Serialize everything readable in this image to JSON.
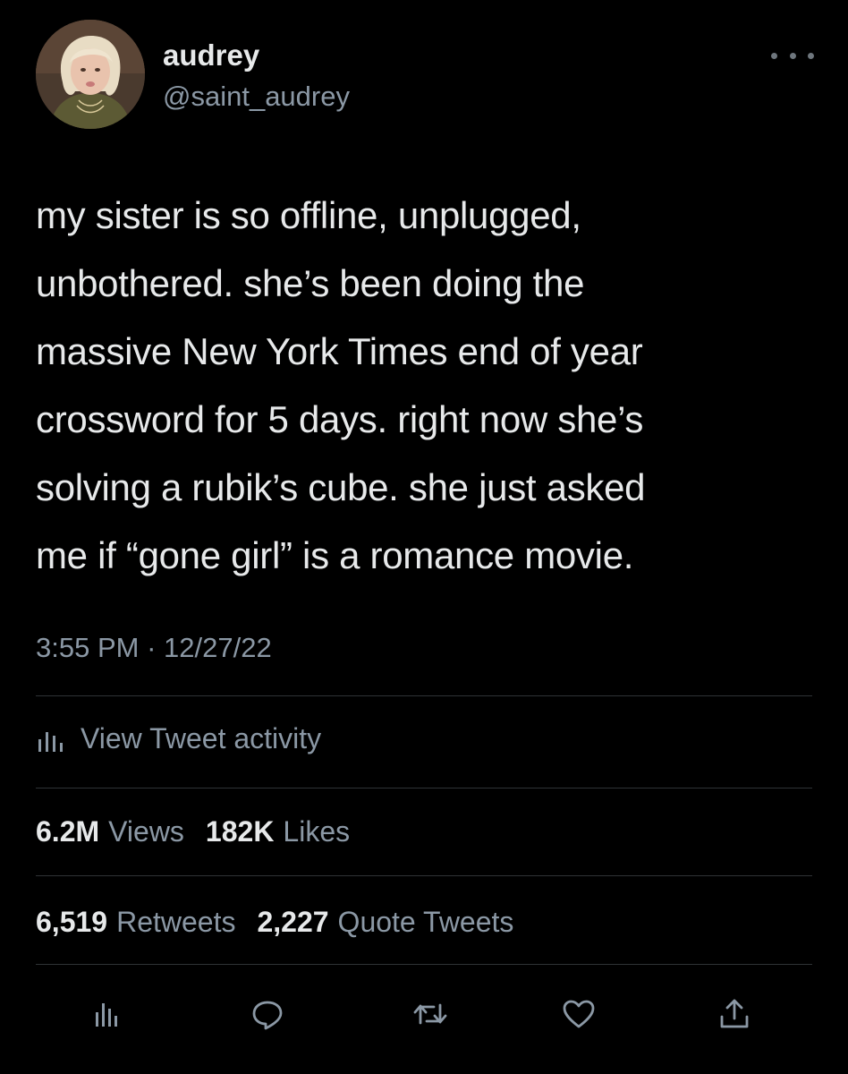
{
  "author": {
    "display_name": "audrey",
    "handle": "@saint_audrey",
    "avatar_icon": "profile-photo"
  },
  "tweet": {
    "text": "my sister is so offline, unplugged,\nunbothered. she’s been doing the\nmassive New York Times end of year\ncrossword for 5 days. right now she’s\nsolving a rubik’s cube. she just asked\nme if “gone girl” is a romance movie.",
    "time": "3:55 PM",
    "separator": "·",
    "date": "12/27/22"
  },
  "activity": {
    "label": "View Tweet activity",
    "icon": "bar-chart-icon"
  },
  "stats": {
    "views_count": "6.2M",
    "views_label": "Views",
    "likes_count": "182K",
    "likes_label": "Likes",
    "retweets_count": "6,519",
    "retweets_label": "Retweets",
    "quotes_count": "2,227",
    "quotes_label": "Quote Tweets"
  },
  "actions": [
    "analytics-icon",
    "reply-icon",
    "retweet-icon",
    "like-icon",
    "share-icon"
  ],
  "colors": {
    "background": "#000000",
    "primary_text": "#e7e9ea",
    "secondary_text": "#8b98a5",
    "divider": "#2f3336"
  }
}
